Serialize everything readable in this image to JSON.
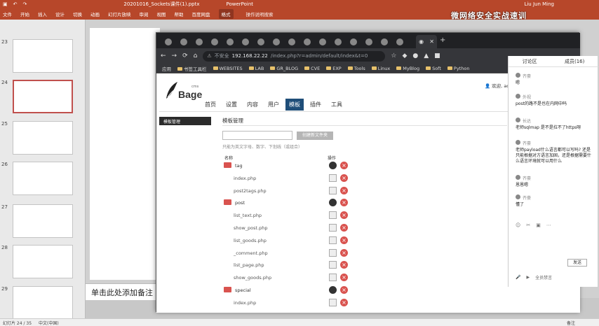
{
  "ppt": {
    "title_file": "20201016_Sockets课件(1).pptx",
    "title_app": "PowerPoint",
    "title_user": "Liu Jun Ming",
    "ribbon_tabs": [
      "文件",
      "开始",
      "插入",
      "设计",
      "切换",
      "动画",
      "幻灯片放映",
      "审阅",
      "视图",
      "帮助",
      "百度网盘",
      "格式",
      "操作说明搜索"
    ],
    "ribbon_active": "格式",
    "overlay_text": "微网络安全实战速训",
    "slide_numbers": [
      "23",
      "24",
      "25",
      "26",
      "27",
      "28",
      "29"
    ],
    "notes_text": "单击此处添加备注",
    "status_left": "幻灯片 24 / 35",
    "status_lang": "中文(中国)",
    "status_right": "备注"
  },
  "browser": {
    "omnibox_insecure": "不安全",
    "omnibox_url": "192.168.22.22",
    "omnibox_path": "/index.php?r=admin/default/index&t=0",
    "bookmarks": [
      "应用",
      "书签工具栏",
      "WEBSITES",
      "LAB",
      "GR_BLOG",
      "CVE",
      "EXP",
      "Tools",
      "Linux",
      "MyBlog",
      "Soft",
      "Python"
    ]
  },
  "page": {
    "logo_text": "Bage",
    "logo_small": "cms",
    "user_info": "欢迎, admin",
    "nav": [
      "首页",
      "设置",
      "内容",
      "用户",
      "模板",
      "插件",
      "工具"
    ],
    "nav_active_index": 4,
    "side_menu": "模板管理",
    "heading": "模板管理",
    "create_button": "创建新文件夹",
    "hint": "只能为英文字母、数字、下划线（或组合）",
    "col_name": "名称",
    "col_op": "操作",
    "rows": [
      {
        "type": "dir",
        "name": "tag"
      },
      {
        "type": "file",
        "name": "index.php"
      },
      {
        "type": "file",
        "name": "post2tags.php"
      },
      {
        "type": "dir",
        "name": "post"
      },
      {
        "type": "file",
        "name": "list_text.php"
      },
      {
        "type": "file",
        "name": "show_post.php"
      },
      {
        "type": "file",
        "name": "list_goods.php"
      },
      {
        "type": "file",
        "name": "_comment.php"
      },
      {
        "type": "file",
        "name": "list_page.php"
      },
      {
        "type": "file",
        "name": "show_goods.php"
      },
      {
        "type": "dir",
        "name": "special"
      },
      {
        "type": "file",
        "name": "index.php"
      }
    ]
  },
  "chat": {
    "tab_discuss": "讨论区",
    "tab_members": "成员(16)",
    "messages": [
      {
        "name": "齐豪",
        "text": "嗯"
      },
      {
        "name": "外视",
        "text": "post的路不是也在内网中吗"
      },
      {
        "name": "长达",
        "text": "老师sqlmap 是不是拉不了https呀"
      },
      {
        "name": "齐豪",
        "text": "老师payload什么语言都可以写吗? 还是只能根据对方语言加固，还是根据需要什么语言环境就可以用什么"
      },
      {
        "name": "齐豪",
        "text": "恩恩嗯"
      },
      {
        "name": "齐豪",
        "text": "懂了"
      }
    ],
    "send": "发送",
    "bottom_hint": "全员禁言"
  }
}
